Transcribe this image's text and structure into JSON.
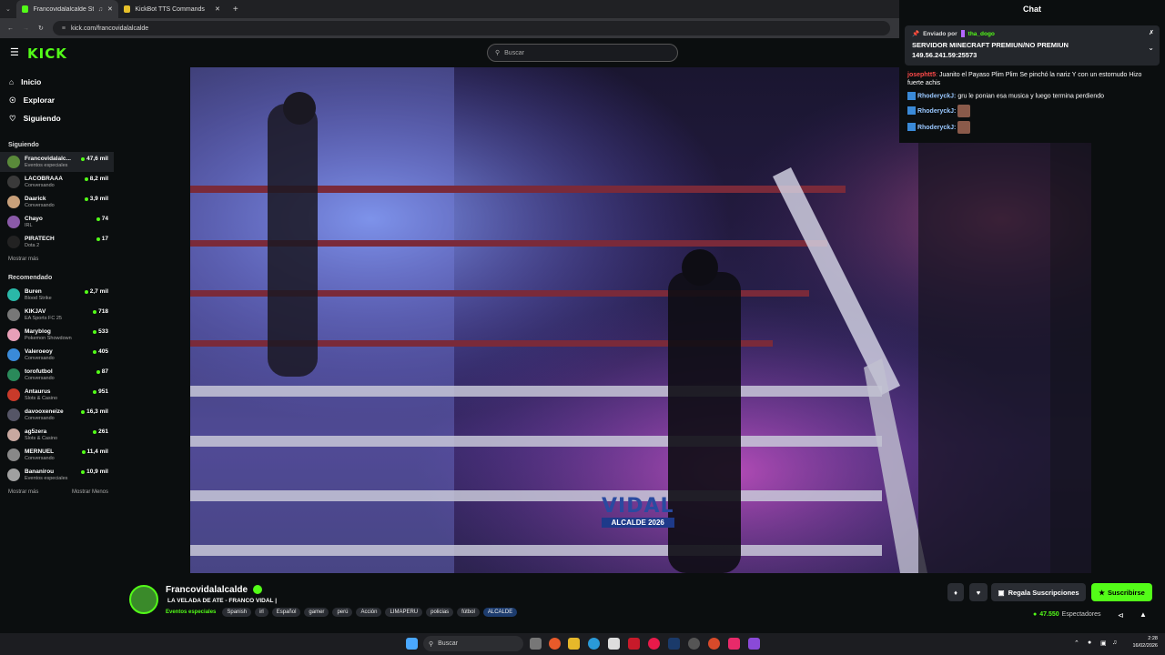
{
  "browser": {
    "tabs": [
      {
        "title": "Francovidalalcalde Stream"
      },
      {
        "title": "KickBot TTS Commands"
      }
    ],
    "url": "kick.com/francovidalalcalde"
  },
  "header": {
    "logo": "KICK",
    "search_placeholder": "Buscar"
  },
  "nav": {
    "items": [
      {
        "label": "Inicio"
      },
      {
        "label": "Explorar"
      },
      {
        "label": "Siguiendo"
      }
    ]
  },
  "following": {
    "title": "Siguiendo",
    "channels": [
      {
        "name": "Francovidalalc...",
        "category": "Eventos especiales",
        "viewers": "47,6 mil"
      },
      {
        "name": "LACOBRAAA",
        "category": "Conversando",
        "viewers": "8,2 mil"
      },
      {
        "name": "Daarick",
        "category": "Conversando",
        "viewers": "3,9 mil"
      },
      {
        "name": "Chayo",
        "category": "IRL",
        "viewers": "74"
      },
      {
        "name": "PIRATECH",
        "category": "Dota 2",
        "viewers": "17"
      }
    ],
    "show_more": "Mostrar más"
  },
  "recommended": {
    "title": "Recomendado",
    "channels": [
      {
        "name": "Buren",
        "category": "Blood Strike",
        "viewers": "2,7 mil"
      },
      {
        "name": "KIKJAV",
        "category": "EA Sports FC 25",
        "viewers": "718"
      },
      {
        "name": "Maryblog",
        "category": "Pokemon Showdown",
        "viewers": "533"
      },
      {
        "name": "Valeroeoy",
        "category": "Conversando",
        "viewers": "405"
      },
      {
        "name": "torofutbol",
        "category": "Conversando",
        "viewers": "87"
      },
      {
        "name": "Antaurus",
        "category": "Slots & Casino",
        "viewers": "951"
      },
      {
        "name": "davooxeneize",
        "category": "Conversando",
        "viewers": "16,3 mil"
      },
      {
        "name": "ag5zera",
        "category": "Slots & Casino",
        "viewers": "261"
      },
      {
        "name": "MERNUEL",
        "category": "Conversando",
        "viewers": "11,4 mil"
      },
      {
        "name": "Bananirou",
        "category": "Eventos especiales",
        "viewers": "10,9 mil"
      }
    ],
    "show_more": "Mostrar más",
    "show_less": "Mostrar Menos"
  },
  "video": {
    "watermark_line1": "VIDAL",
    "watermark_line2": "ALCALDE 2026"
  },
  "chat": {
    "title": "Chat",
    "pinned_by_label": "Enviado por",
    "pinned_by_user": "tha_dogo",
    "pinned_line1": "SERVIDOR MINECRAFT PREMIUN/NO PREMIUN",
    "pinned_line2": "149.56.241.59:25573",
    "messages": [
      {
        "user": "josephtt5",
        "text": "Juanito el Payaso Plim Plim Se pinchó la nariz Y con un estornudo Hizo fuerte achis"
      },
      {
        "user": "RhoderyckJ:",
        "text": "gru le ponian esa musica y luego termina perdiendo"
      },
      {
        "user": "RhoderyckJ:",
        "text": ""
      },
      {
        "user": "RhoderyckJ:",
        "text": ""
      }
    ]
  },
  "stream": {
    "streamer": "Francovidalalcalde",
    "title": "LA VELADA DE ATE - FRANCO VIDAL |",
    "category": "Eventos especiales",
    "tags": [
      "Spanish",
      "irl",
      "Español",
      "gamer",
      "perú",
      "Acción",
      "LIMAPERU",
      "policias",
      "fútbol",
      "ALCALDE"
    ],
    "gift_label": "Regala Suscripciones",
    "subscribe_label": "Suscribirse",
    "viewers_count": "47.550",
    "viewers_label": "Espectadores"
  },
  "taskbar": {
    "search_placeholder": "Buscar",
    "time": "2:28",
    "date": "16/02/2026"
  }
}
